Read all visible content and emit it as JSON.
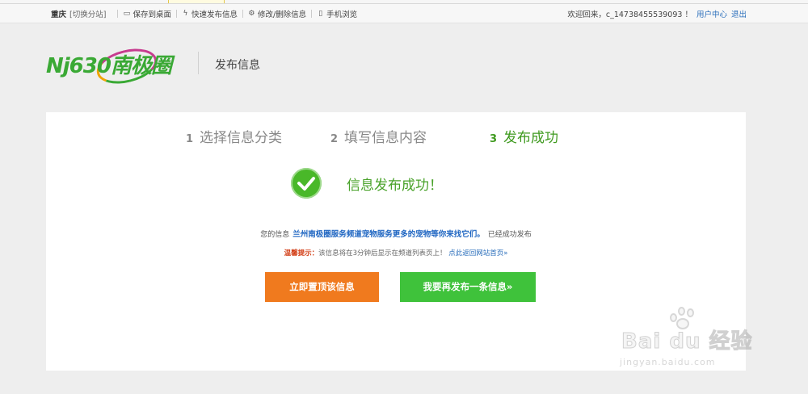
{
  "topbar": {
    "city": "重庆",
    "switch_city": "[切换分站]",
    "links": [
      {
        "icon": "monitor-icon",
        "label": "保存到桌面"
      },
      {
        "icon": "lightning-icon",
        "label": "快速发布信息"
      },
      {
        "icon": "gear-icon",
        "label": "修改/删除信息"
      },
      {
        "icon": "phone-icon",
        "label": "手机浏览"
      }
    ],
    "welcome": "欢迎回来，c_14738455539093 ！",
    "user_center": "用户中心",
    "logout": "退出"
  },
  "header": {
    "logo_text": "Nj630南极圈",
    "page_title": "发布信息"
  },
  "steps": [
    {
      "num": "1",
      "label": "选择信息分类",
      "active": false
    },
    {
      "num": "2",
      "label": "填写信息内容",
      "active": false
    },
    {
      "num": "3",
      "label": "发布成功",
      "active": true
    }
  ],
  "success": {
    "icon": "checkmark-circle-icon",
    "message": "信息发布成功！"
  },
  "info": {
    "prefix": "您的信息",
    "title": "兰州南极圈服务频道宠物服务更多的宠物等你来找它们。",
    "suffix": "已经成功发布"
  },
  "tip": {
    "label": "温馨提示：",
    "text": "该信息将在3分钟后显示在频道列表页上！",
    "link": "点此返回网站首页»"
  },
  "buttons": {
    "top": "立即置顶该信息",
    "again": "我要再发布一条信息»"
  },
  "colors": {
    "accent_green": "#3f9a1f",
    "button_orange": "#f07a1e",
    "button_green": "#3fc23b",
    "link_blue": "#2a6ebb"
  },
  "watermark": {
    "main": "Bai du 经验",
    "sub": "jingyan.baidu.com"
  }
}
